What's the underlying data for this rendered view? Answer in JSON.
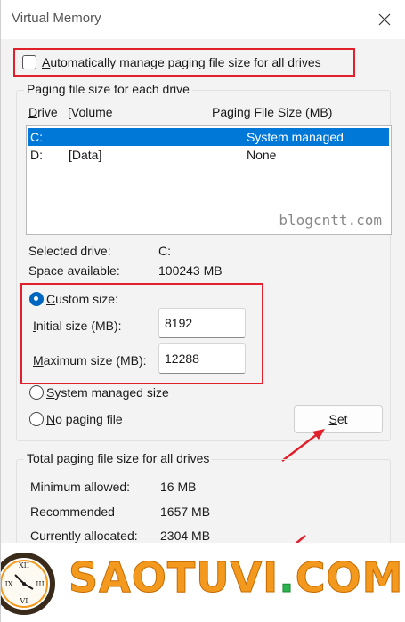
{
  "window": {
    "title": "Virtual Memory"
  },
  "auto_manage": {
    "label": "Automatically manage paging file size for all drives",
    "checked": false
  },
  "paging_group": {
    "legend": "Paging file size for each drive",
    "columns": {
      "drive": "Drive",
      "volume": "[Volume",
      "size": "Paging File Size (MB)"
    },
    "drives": [
      {
        "drive": "C:",
        "volume": "",
        "size": "System managed",
        "selected": true
      },
      {
        "drive": "D:",
        "volume": "[Data]",
        "size": "None",
        "selected": false
      }
    ],
    "watermark": "blogcntt.com"
  },
  "selected_drive": {
    "label": "Selected drive:",
    "value": "C:"
  },
  "space_available": {
    "label": "Space available:",
    "value": "100243 MB"
  },
  "custom_size": {
    "label": "Custom size:",
    "initial_label": "Initial size (MB):",
    "initial_value": "8192",
    "maximum_label": "Maximum size (MB):",
    "maximum_value": "12288"
  },
  "system_managed": {
    "label": "System managed size"
  },
  "no_paging": {
    "label": "No paging file"
  },
  "set_button": {
    "label": "Set"
  },
  "total_group": {
    "legend": "Total paging file size for all drives",
    "rows": [
      {
        "label": "Minimum allowed:",
        "value": "16 MB"
      },
      {
        "label": "Recommended",
        "value": "1657 MB"
      },
      {
        "label": "Currently allocated:",
        "value": "2304 MB"
      }
    ]
  },
  "brand": {
    "name": "SAOTUVI",
    "dot": ".",
    "tld": "COM"
  },
  "colors": {
    "highlight_red": "#e0202a",
    "selection_blue": "#0078d7",
    "brand_orange": "#f39a1e",
    "brand_green": "#2bb24c"
  }
}
